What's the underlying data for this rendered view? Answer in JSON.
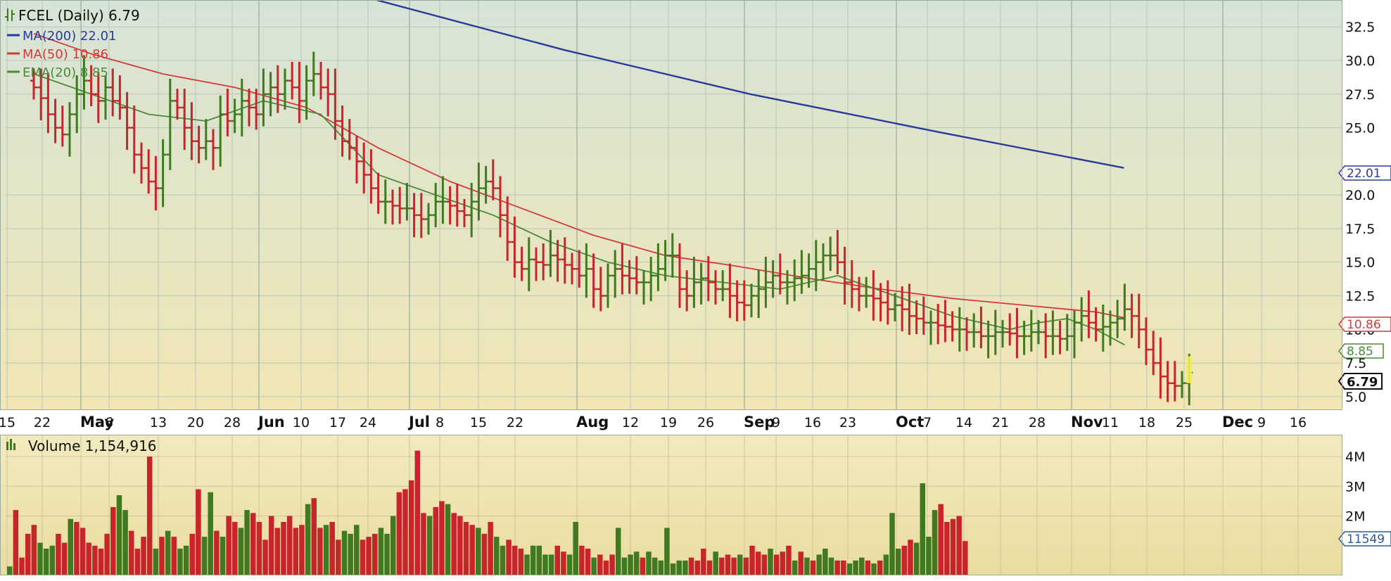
{
  "legend": {
    "main": "FCEL (Daily) 6.79",
    "ma200": "MA(200) 22.01",
    "ma50": "MA(50) 10.86",
    "ema20": "EMA(20) 8.85",
    "volume": "Volume 1,154,916"
  },
  "price_tags": {
    "ma200": "22.01",
    "ma50": "10.86",
    "ema20": "8.85",
    "last": "6.79",
    "volume": "11549"
  },
  "colors": {
    "up": "#3f7a20",
    "down": "#c8252b",
    "ma200": "#2a3a9a",
    "ma50": "#d4393d",
    "ema20": "#4b8a3a",
    "grid": "#b8c7b8",
    "text": "#111111"
  },
  "chart_data": [
    {
      "type": "bar",
      "title": "FCEL (Daily) 6.79",
      "ylim": [
        4.0,
        34.5
      ],
      "y_ticks": [
        "32.5",
        "30.0",
        "27.5",
        "25.0",
        "20.0",
        "17.5",
        "15.0",
        "12.5",
        "10.0",
        "7.5",
        "5.0"
      ],
      "x_tick_labels": [
        "15",
        "22",
        "May",
        "6",
        "13",
        "20",
        "28",
        "Jun",
        "10",
        "17",
        "24",
        "Jul",
        "8",
        "15",
        "22",
        "Aug",
        "12",
        "19",
        "26",
        "Sep",
        "9",
        "16",
        "23",
        "Oct",
        "7",
        "14",
        "21",
        "28",
        "Nov",
        "11",
        "18",
        "25",
        "Dec",
        "9",
        "16"
      ],
      "series": [
        {
          "name": "FCEL (Daily)",
          "kind": "ohlc",
          "close": [
            28.0,
            27.2,
            26.0,
            25.0,
            24.5,
            26.0,
            27.5,
            28.5,
            27.5,
            27.0,
            28.0,
            27.0,
            26.5,
            25.0,
            23.0,
            22.0,
            21.0,
            20.5,
            23.0,
            27.0,
            26.5,
            25.0,
            24.0,
            23.5,
            24.0,
            23.5,
            26.0,
            25.5,
            26.0,
            27.0,
            26.5,
            26.0,
            27.5,
            28.0,
            27.5,
            28.5,
            28.0,
            27.0,
            28.5,
            29.0,
            28.0,
            27.5,
            25.5,
            24.0,
            23.5,
            22.5,
            21.5,
            20.5,
            19.5,
            19.5,
            19.2,
            19.0,
            19.0,
            18.5,
            18.2,
            18.5,
            19.5,
            19.5,
            19.2,
            18.8,
            18.5,
            19.5,
            20.5,
            21.0,
            20.5,
            18.5,
            16.5,
            15.0,
            14.5,
            15.2,
            15.0,
            14.8,
            15.5,
            15.2,
            14.8,
            14.5,
            14.0,
            14.5,
            13.0,
            12.5,
            14.0,
            14.5,
            14.0,
            13.8,
            13.5,
            13.5,
            14.0,
            14.5,
            15.5,
            15.5,
            13.0,
            12.5,
            13.5,
            13.8,
            13.5,
            13.0,
            13.0,
            12.5,
            12.0,
            11.8,
            12.5,
            13.0,
            13.5,
            14.0,
            13.5,
            13.5,
            13.8,
            14.0,
            14.5,
            15.0,
            15.5,
            15.5,
            15.0,
            13.5,
            13.0,
            12.5,
            12.5,
            12.3,
            12.0,
            11.5,
            11.8,
            11.5,
            11.0,
            10.8,
            10.5,
            10.5,
            10.3,
            10.2,
            10.0,
            10.0,
            9.8,
            9.8,
            9.5,
            9.5,
            9.8,
            9.8,
            9.7,
            9.5,
            9.5,
            9.8,
            9.8,
            9.5,
            9.5,
            9.3,
            9.5,
            10.5,
            11.0,
            10.5,
            10.0,
            10.2,
            10.5,
            10.8,
            11.5,
            11.0,
            10.0,
            8.5,
            7.5,
            6.5,
            6.0,
            5.8,
            6.0,
            6.79
          ]
        },
        {
          "name": "MA(200)",
          "x": [
            88,
            104,
            120,
            136,
            152
          ],
          "y": [
            34.5,
            30.8,
            27.5,
            24.7,
            22.01
          ]
        },
        {
          "name": "MA(50)",
          "x": [
            0,
            8,
            18,
            28,
            38,
            48,
            58,
            68,
            78,
            88,
            98,
            108,
            118,
            128,
            138,
            148,
            152
          ],
          "y": [
            32.0,
            30.5,
            29.0,
            28.0,
            26.5,
            23.5,
            21.0,
            19.0,
            17.0,
            15.5,
            14.7,
            13.8,
            13.0,
            12.3,
            11.8,
            11.3,
            10.86
          ]
        },
        {
          "name": "EMA(20)",
          "x": [
            0,
            8,
            16,
            24,
            32,
            40,
            48,
            56,
            64,
            72,
            80,
            88,
            96,
            104,
            112,
            120,
            128,
            136,
            140,
            144,
            148,
            152
          ],
          "y": [
            29.0,
            27.5,
            26.0,
            25.5,
            27.0,
            26.0,
            21.5,
            20.0,
            18.5,
            16.5,
            15.0,
            14.0,
            13.5,
            13.0,
            14.0,
            12.5,
            11.0,
            10.0,
            10.5,
            10.8,
            10.0,
            8.85
          ]
        }
      ]
    },
    {
      "type": "bar",
      "title": "Volume 1,154,916",
      "ylim": [
        0,
        4500000
      ],
      "y_ticks": [
        "4M",
        "3M",
        "2M"
      ],
      "series": [
        {
          "name": "Volume",
          "values": [
            300000,
            2200000,
            600000,
            1400000,
            1700000,
            1100000,
            900000,
            1000000,
            1400000,
            1100000,
            1900000,
            1800000,
            1600000,
            1100000,
            1000000,
            900000,
            1400000,
            2300000,
            2700000,
            2200000,
            1500000,
            900000,
            1300000,
            4000000,
            900000,
            1300000,
            1500000,
            1300000,
            900000,
            1000000,
            1400000,
            2900000,
            1300000,
            2800000,
            1500000,
            1300000,
            2000000,
            1800000,
            1600000,
            2200000,
            2100000,
            1800000,
            1200000,
            2000000,
            1600000,
            1800000,
            2000000,
            1600000,
            1700000,
            2400000,
            2600000,
            1600000,
            1700000,
            1800000,
            1200000,
            1500000,
            1400000,
            1700000,
            1200000,
            1300000,
            1400000,
            1600000,
            1400000,
            2000000,
            2800000,
            2900000,
            3200000,
            4200000,
            2100000,
            2000000,
            2300000,
            2500000,
            2400000,
            2100000,
            2000000,
            1800000,
            1700000,
            1600000,
            1400000,
            1800000,
            1300000,
            1000000,
            1200000,
            1000000,
            900000,
            700000,
            1000000,
            1000000,
            700000,
            700000,
            1000000,
            800000,
            700000,
            1800000,
            1000000,
            900000,
            600000,
            700000,
            500000,
            700000,
            1600000,
            600000,
            700000,
            800000,
            600000,
            800000,
            600000,
            500000,
            1600000,
            400000,
            500000,
            500000,
            600000,
            500000,
            900000,
            500000,
            800000,
            600000,
            700000,
            600000,
            700000,
            600000,
            1000000,
            800000,
            700000,
            900000,
            700000,
            800000,
            1000000,
            500000,
            800000,
            600000,
            500000,
            700000,
            900000,
            600000,
            500000,
            500000,
            400000,
            500000,
            600000,
            500000,
            400000,
            500000,
            700000,
            2100000,
            900000,
            1000000,
            1200000,
            1100000,
            3100000,
            1300000,
            2200000,
            2400000,
            1800000,
            1900000,
            2000000,
            1154916
          ]
        }
      ]
    }
  ]
}
